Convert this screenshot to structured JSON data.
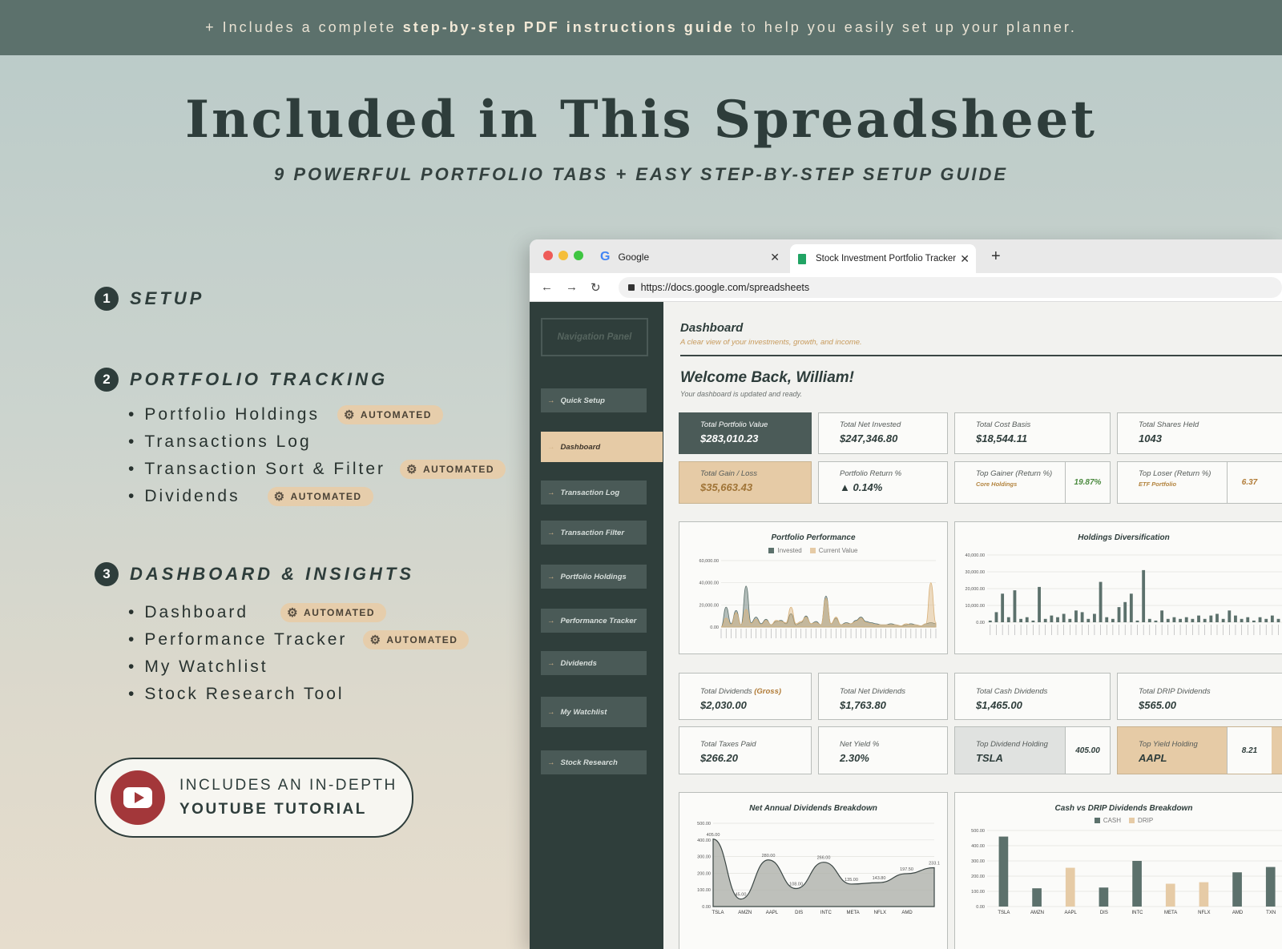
{
  "banner": {
    "prefix": "+ Includes a complete",
    "bold": "step-by-step PDF instructions guide",
    "suffix": "to help you easily set up your planner."
  },
  "hero": {
    "title": "Included in This Spreadsheet",
    "subtitle": "9 POWERFUL PORTFOLIO TABS + EASY STEP-BY-STEP SETUP GUIDE"
  },
  "sections": [
    {
      "num": "1",
      "title": "SETUP",
      "items": []
    },
    {
      "num": "2",
      "title": "PORTFOLIO TRACKING",
      "items": [
        {
          "label": "Portfolio Holdings",
          "badge": "AUTOMATED"
        },
        {
          "label": "Transactions Log",
          "badge": ""
        },
        {
          "label": "Transaction Sort & Filter",
          "badge": "AUTOMATED"
        },
        {
          "label": "Dividends",
          "badge": "AUTOMATED"
        }
      ]
    },
    {
      "num": "3",
      "title": "DASHBOARD & INSIGHTS",
      "items": [
        {
          "label": "Dashboard",
          "badge": "AUTOMATED"
        },
        {
          "label": "Performance Tracker",
          "badge": "AUTOMATED"
        },
        {
          "label": "My Watchlist",
          "badge": ""
        },
        {
          "label": "Stock Research Tool",
          "badge": ""
        }
      ]
    }
  ],
  "youtube": {
    "line1": "INCLUDES AN IN-DEPTH",
    "line2": "YOUTUBE TUTORIAL"
  },
  "browser": {
    "tab1": "Google",
    "tab2": "Stock Investment Portfolio Tracker",
    "url": "https://docs.google.com/spreadsheets"
  },
  "sidebar": {
    "panel": "Navigation Panel",
    "items": [
      "Quick Setup",
      "Dashboard",
      "Transaction Log",
      "Transaction Filter",
      "Portfolio Holdings",
      "Performance Tracker",
      "Dividends",
      "My Watchlist",
      "Stock Research"
    ]
  },
  "dashboard": {
    "title": "Dashboard",
    "subtitle": "A clear view of your investments, growth, and income.",
    "welcome": "Welcome Back, William!",
    "welcome_sub": "Your dashboard is updated and ready."
  },
  "cards": {
    "total_value": {
      "label": "Total Portfolio Value",
      "value": "$283,010.23"
    },
    "net_invested": {
      "label": "Total Net Invested",
      "value": "$247,346.80"
    },
    "cost_basis": {
      "label": "Total Cost Basis",
      "value": "$18,544.11"
    },
    "shares_held": {
      "label": "Total Shares Held",
      "value": "1043"
    },
    "gain_loss": {
      "label": "Total Gain / Loss",
      "value": "$35,663.43"
    },
    "return_pct": {
      "label": "Portfolio Return %",
      "value": "▲ 0.14%"
    },
    "top_gainer": {
      "label": "Top Gainer (Return %)",
      "sub": "Core Holdings",
      "value": "19.87%"
    },
    "top_loser": {
      "label": "Top Loser (Return %)",
      "sub": "ETF Portfolio",
      "value": "6.37"
    },
    "div_gross": {
      "label": "Total Dividends",
      "label_note": "(Gross)",
      "value": "$2,030.00"
    },
    "div_net": {
      "label": "Total Net Dividends",
      "value": "$1,763.80"
    },
    "div_cash": {
      "label": "Total Cash Dividends",
      "value": "$1,465.00"
    },
    "div_drip": {
      "label": "Total DRIP Dividends",
      "value": "$565.00"
    },
    "taxes": {
      "label": "Total Taxes Paid",
      "value": "$266.20"
    },
    "net_yield": {
      "label": "Net Yield %",
      "value": "2.30%"
    },
    "top_div": {
      "label": "Top Dividend Holding",
      "name": "TSLA",
      "value": "405.00"
    },
    "top_yield": {
      "label": "Top Yield Holding",
      "name": "AAPL",
      "value": "8.21"
    }
  },
  "colors": {
    "dark": "#2f3e3b",
    "tan": "#e6cba6",
    "bar": "#5c716c",
    "area": "#a9aca5"
  },
  "chart_data": [
    {
      "type": "area",
      "title": "Portfolio Performance",
      "series": [
        {
          "name": "Invested",
          "values": [
            0,
            18000,
            3000,
            15000,
            2000,
            37000,
            4000,
            9000,
            3000,
            7000,
            2000,
            5000,
            6000,
            3000,
            12000,
            2000,
            4000,
            10000,
            3000,
            5000,
            2000,
            28000,
            3000,
            8000,
            2000,
            4000,
            3000,
            6000,
            9000,
            5000,
            4000,
            3000,
            2000,
            2000,
            3000,
            2000,
            1000,
            2000,
            3000,
            2000,
            1000,
            3000,
            4000,
            3000
          ]
        },
        {
          "name": "Current Value",
          "values": [
            0,
            8000,
            2000,
            13000,
            2000,
            16000,
            3000,
            7000,
            2000,
            6000,
            2000,
            6000,
            5000,
            4000,
            18000,
            3000,
            5000,
            9000,
            3000,
            4000,
            2000,
            26000,
            3000,
            9000,
            2000,
            3000,
            3000,
            5000,
            8000,
            4000,
            3000,
            2000,
            2000,
            2000,
            2000,
            2000,
            1000,
            3000,
            2000,
            2000,
            1000,
            3000,
            40000,
            4000
          ]
        }
      ],
      "ylim": [
        0,
        60000
      ],
      "yticks": [
        "60,000.00",
        "40,000.00",
        "20,000.00",
        "0.00"
      ]
    },
    {
      "type": "bar",
      "title": "Holdings Diversification",
      "values": [
        1000,
        6000,
        17000,
        3000,
        19000,
        2000,
        3000,
        1000,
        21000,
        2000,
        4000,
        3000,
        5000,
        2000,
        7000,
        6000,
        2000,
        5000,
        24000,
        3000,
        2000,
        9000,
        12000,
        17000,
        1000,
        31000,
        2000,
        1000,
        7000,
        2000,
        3000,
        2000,
        3000,
        2000,
        4000,
        2000,
        4000,
        5000,
        2000,
        7000,
        4000,
        2000,
        3000,
        1000,
        3000,
        2000,
        4000,
        2000,
        4000
      ],
      "ylim": [
        0,
        40000
      ],
      "yticks": [
        "40,000.00",
        "30,000.00",
        "20,000.00",
        "10,000.00",
        "0.00"
      ]
    },
    {
      "type": "area",
      "title": "Net Annual Dividends Breakdown",
      "categories": [
        "TSLA",
        "AMZN",
        "AAPL",
        "DIS",
        "INTC",
        "META",
        "NFLX",
        "AMD"
      ],
      "values": [
        405,
        45,
        280,
        108,
        266,
        135,
        143.8,
        197.5,
        233.1
      ],
      "ylim": [
        0,
        500
      ],
      "yticks": [
        "500.00",
        "400.00",
        "300.00",
        "200.00",
        "100.00",
        "0.00"
      ]
    },
    {
      "type": "bar",
      "title": "Cash vs DRIP Dividends Breakdown",
      "categories": [
        "TSLA",
        "AMZN",
        "AAPL",
        "DIS",
        "INTC",
        "META",
        "NFLX",
        "AMD",
        "TXN"
      ],
      "series": [
        {
          "name": "CASH",
          "values": [
            460,
            120,
            0,
            125,
            300,
            0,
            0,
            225,
            260
          ]
        },
        {
          "name": "DRIP",
          "values": [
            0,
            0,
            255,
            0,
            0,
            150,
            160,
            0,
            0
          ]
        }
      ],
      "ylim": [
        0,
        500
      ],
      "yticks": [
        "500.00",
        "400.00",
        "300.00",
        "200.00",
        "100.00",
        "0.00"
      ]
    }
  ]
}
